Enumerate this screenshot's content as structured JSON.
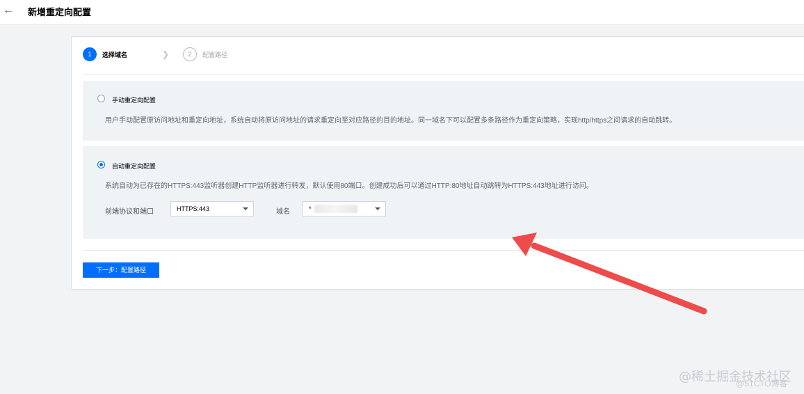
{
  "header": {
    "back_icon": "arrow-left-icon",
    "title": "新增重定向配置"
  },
  "steps": [
    {
      "number": "1",
      "label": "选择域名",
      "state": "active"
    },
    {
      "number": "2",
      "label": "配置路径",
      "state": "inactive"
    }
  ],
  "options": {
    "manual": {
      "title": "手动重定向配置",
      "description": "用户手动配置原访问地址和重定向地址，系统自动将原访问地址的请求重定向至对应路径的目的地址。同一域名下可以配置多条路径作为重定向策略，实现http/https之间请求的自动跳转。",
      "checked": false
    },
    "auto": {
      "title": "自动重定向配置",
      "description": "系统自动为已存在的HTTPS:443监听器创建HTTP监听器进行转发，默认使用80端口。创建成功后可以通过HTTP:80地址自动跳转为HTTPS:443地址进行访问。",
      "checked": true,
      "protocol_label": "前端协议和端口",
      "protocol_value": "HTTPS:443",
      "domain_label": "域名",
      "domain_value": "*"
    }
  },
  "actions": {
    "next_label": "下一步：配置路径"
  },
  "watermark": {
    "line1": "@稀土掘金技术社区",
    "line2": "@51CTO博客"
  },
  "colors": {
    "primary": "#006eff",
    "annotation_arrow": "#ee4b4b"
  }
}
